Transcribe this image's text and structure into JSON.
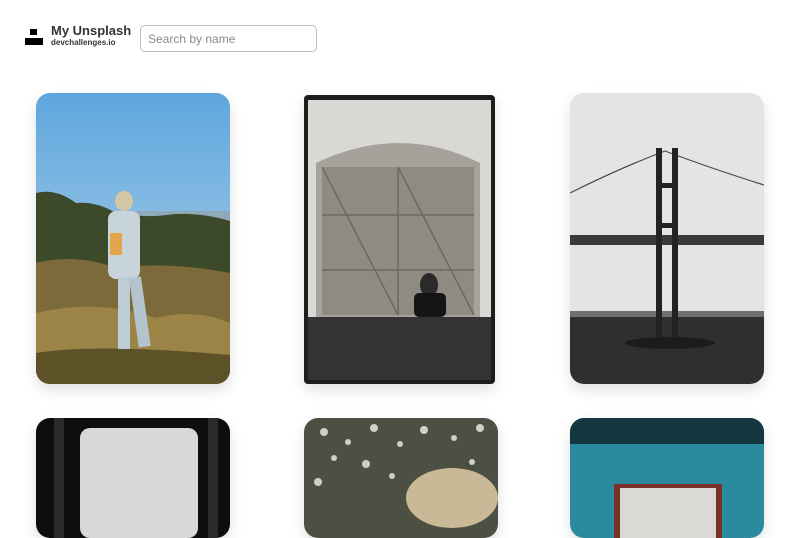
{
  "brand": {
    "title": "My Unsplash",
    "subtitle": "devchallenges.io"
  },
  "search": {
    "placeholder": "Search by name",
    "value": ""
  },
  "gallery": {
    "photos": [
      {
        "subject": "person-on-hill"
      },
      {
        "subject": "wooden-barn-door"
      },
      {
        "subject": "suspension-bridge"
      },
      {
        "subject": "dark-frame"
      },
      {
        "subject": "flowers-closeup"
      },
      {
        "subject": "blue-wall-sign"
      }
    ]
  }
}
